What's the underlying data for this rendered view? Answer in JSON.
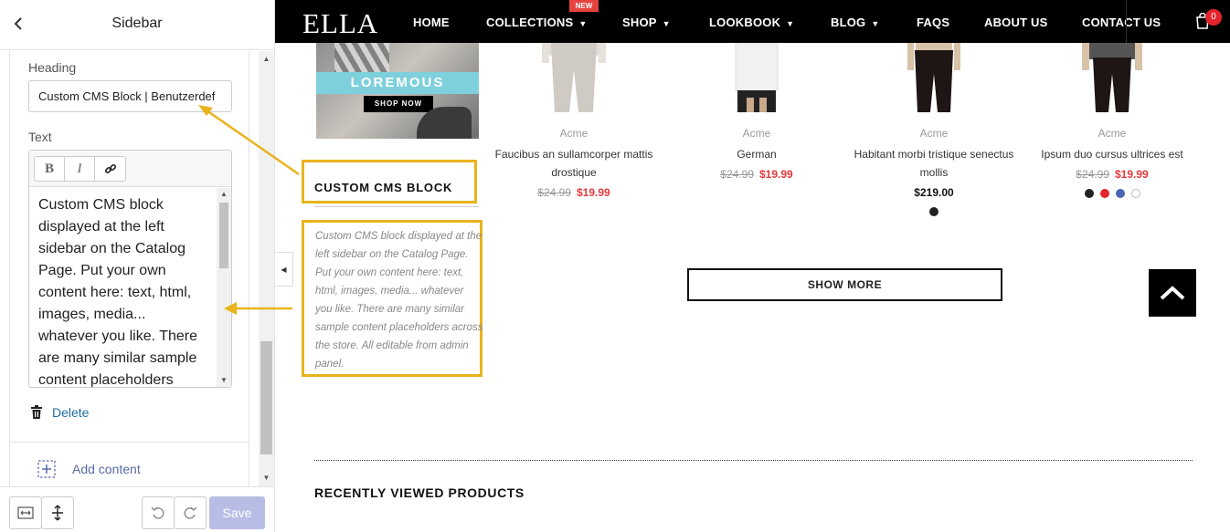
{
  "editor": {
    "title": "Sidebar",
    "back_icon": "chevron-left-icon",
    "heading_label": "Heading",
    "heading_value": "Custom CMS Block | Benutzerdef",
    "text_label": "Text",
    "toolbar": {
      "bold": "B",
      "italic": "I",
      "link_icon": "link-icon"
    },
    "text_value": "Custom CMS block displayed at the left sidebar on the Catalog Page. Put your own content here: text, html, images, media... whatever you like. There are many similar sample content placeholders across the store. All editable from admin panel.",
    "delete_label": "Delete",
    "add_content_label": "Add content",
    "save_label": "Save"
  },
  "store": {
    "logo": "ELLA",
    "nav": [
      "HOME",
      "COLLECTIONS",
      "SHOP",
      "LOOKBOOK",
      "BLOG",
      "FAQS",
      "ABOUT US",
      "CONTACT US"
    ],
    "new_badge": "NEW",
    "cart_count": "0",
    "banner": {
      "headline": "LOREMOUS",
      "cta": "SHOP NOW"
    },
    "cms_block": {
      "title": "CUSTOM CMS BLOCK",
      "text": "Custom CMS block displayed at the left sidebar on the Catalog Page. Put your own content here: text, html, images, media... whatever you like. There are many similar sample content placeholders across the store. All editable from admin panel."
    },
    "products": [
      {
        "brand": "Acme",
        "name": "Faucibus an sullamcorper mattis drostique",
        "old_price": "$24.99",
        "price": "$19.99",
        "swatches": []
      },
      {
        "brand": "Acme",
        "name": "German",
        "old_price": "$24.99",
        "price": "$19.99",
        "swatches": []
      },
      {
        "brand": "Acme",
        "name": "Habitant morbi tristique senectus mollis",
        "old_price": "",
        "price": "$219.00",
        "swatches": [
          "#222222"
        ]
      },
      {
        "brand": "Acme",
        "name": "Ipsum duo cursus ultrices est",
        "old_price": "$24.99",
        "price": "$19.99",
        "swatches": [
          "#222222",
          "#e4232c",
          "#4a66b5",
          "#ffffff"
        ]
      }
    ],
    "show_more": "SHOW MORE",
    "recently_viewed": "RECENTLY VIEWED PRODUCTS"
  },
  "colors": {
    "highlight": "#e9b31b",
    "sale": "#e4393c",
    "link": "#1d6fa5",
    "save_disabled": "#b8bde6"
  }
}
